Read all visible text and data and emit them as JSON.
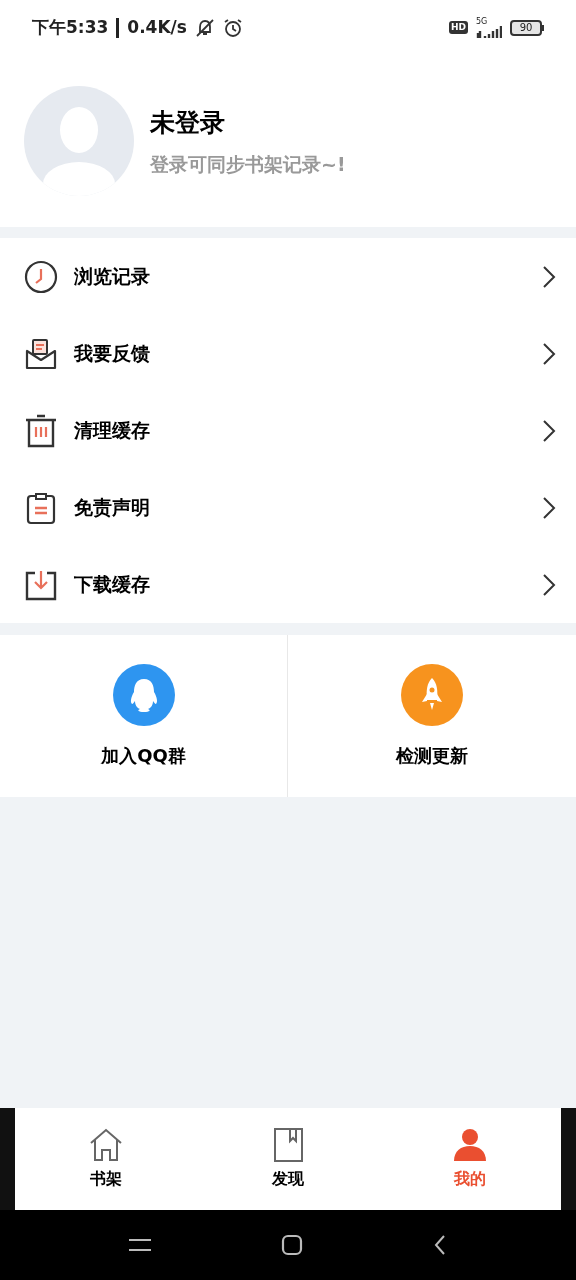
{
  "status_bar": {
    "time": "下午5:33",
    "speed": "0.4K/s",
    "network": "5G",
    "battery": "90",
    "hd": "HD"
  },
  "profile": {
    "name": "未登录",
    "subtitle": "登录可同步书架记录~!"
  },
  "menu": [
    {
      "label": "浏览记录"
    },
    {
      "label": "我要反馈"
    },
    {
      "label": "清理缓存"
    },
    {
      "label": "免责声明"
    },
    {
      "label": "下载缓存"
    }
  ],
  "actions": [
    {
      "label": "加入QQ群",
      "color": "#2e95f0"
    },
    {
      "label": "检测更新",
      "color": "#f7931e"
    }
  ],
  "bottom_nav": [
    {
      "label": "书架",
      "selected": false
    },
    {
      "label": "发现",
      "selected": false
    },
    {
      "label": "我的",
      "selected": true
    }
  ]
}
